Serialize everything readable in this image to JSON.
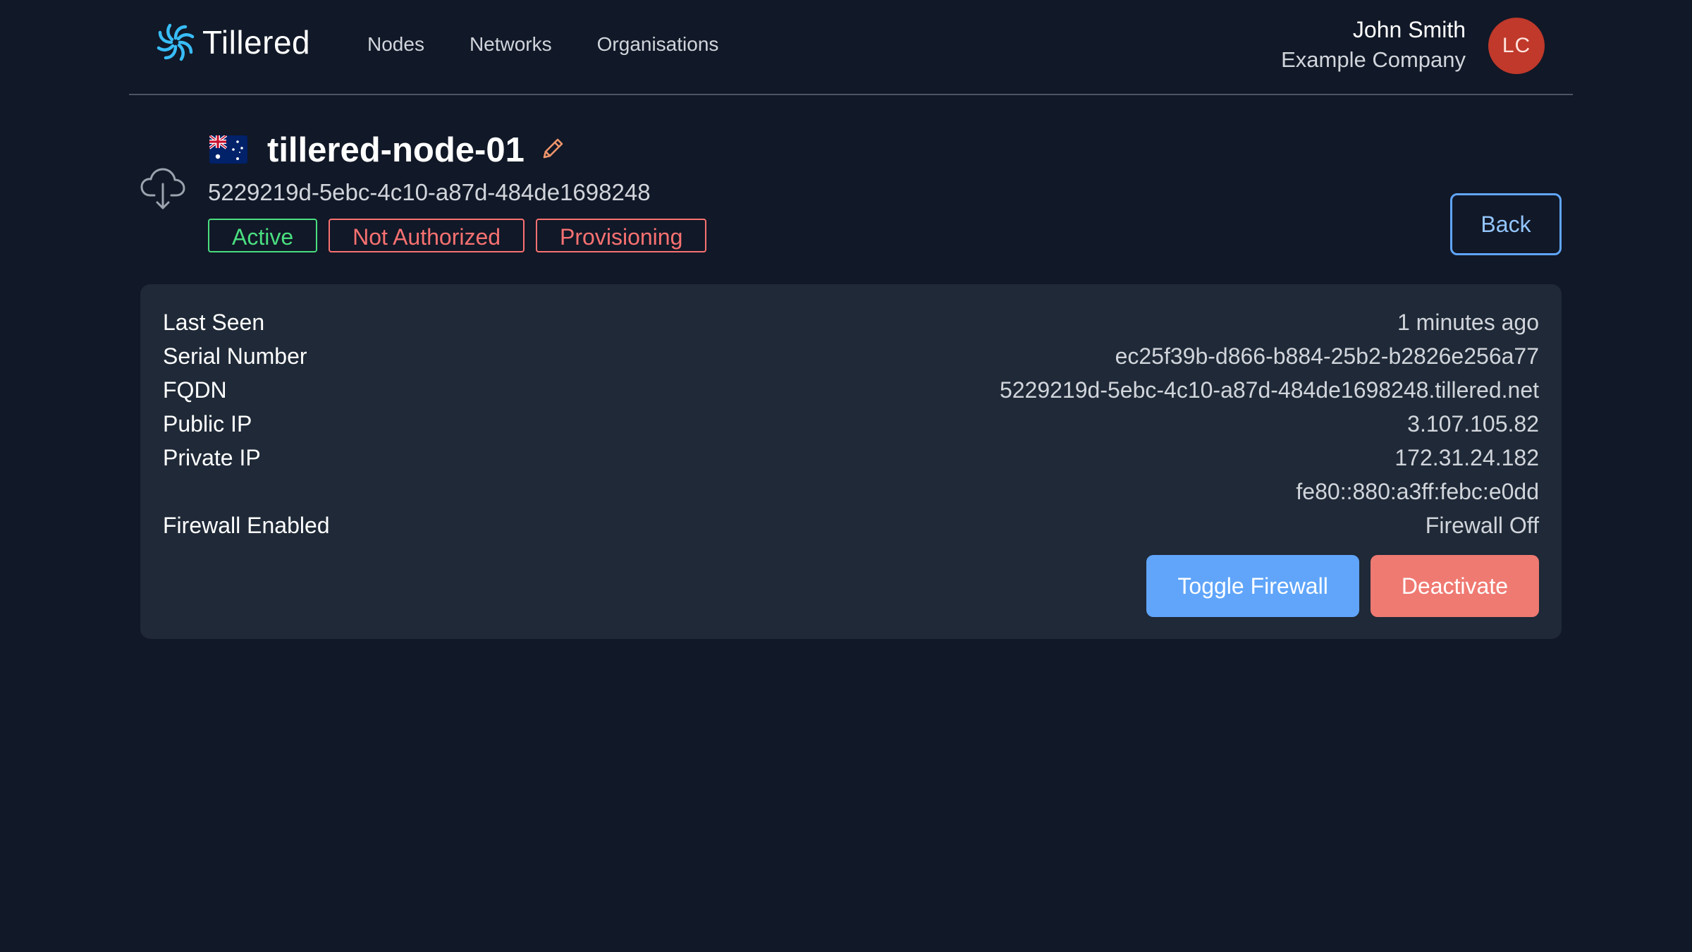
{
  "brand": {
    "name": "Tillered",
    "logo_icon": "tillered-swirl-logo"
  },
  "nav": {
    "items": [
      "Nodes",
      "Networks",
      "Organisations"
    ]
  },
  "user": {
    "name": "John Smith",
    "company": "Example Company",
    "initials": "LC",
    "avatar_color": "#c0392b"
  },
  "node": {
    "status_icon": "cloud-download-icon",
    "flag_icon": "australia-flag-icon",
    "name": "tillered-node-01",
    "edit_icon": "pencil-icon",
    "id": "5229219d-5ebc-4c10-a87d-484de1698248",
    "badges": {
      "active": "Active",
      "not_authorized": "Not Authorized",
      "provisioning": "Provisioning"
    },
    "back_label": "Back"
  },
  "details": {
    "last_seen_label": "Last Seen",
    "last_seen_value": "1 minutes ago",
    "serial_label": "Serial Number",
    "serial_value": "ec25f39b-d866-b884-25b2-b2826e256a77",
    "fqdn_label": "FQDN",
    "fqdn_value": "5229219d-5ebc-4c10-a87d-484de1698248.tillered.net",
    "public_ip_label": "Public IP",
    "public_ip_value": "3.107.105.82",
    "private_ip_label": "Private IP",
    "private_ip_value_1": "172.31.24.182",
    "private_ip_value_2": "fe80::880:a3ff:febc:e0dd",
    "firewall_label": "Firewall Enabled",
    "firewall_value": "Firewall Off"
  },
  "actions": {
    "toggle_firewall": "Toggle Firewall",
    "deactivate": "Deactivate"
  },
  "colors": {
    "background": "#111827",
    "card": "#1f2937",
    "active": "#4ade80",
    "danger": "#f87171",
    "primary": "#60a5fa",
    "logo": "#38bdf8",
    "edit_icon": "#f0956b"
  }
}
